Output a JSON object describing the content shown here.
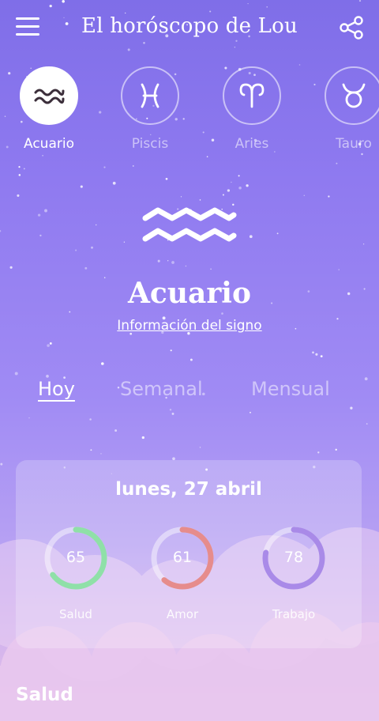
{
  "header": {
    "title": "El horóscopo de Lou",
    "menu_icon": "hamburger-menu-icon",
    "share_icon": "share-icon"
  },
  "signs": [
    {
      "label": "Acuario",
      "icon": "aquarius-icon",
      "active": true
    },
    {
      "label": "Piscis",
      "icon": "pisces-icon",
      "active": false
    },
    {
      "label": "Aries",
      "icon": "aries-icon",
      "active": false
    },
    {
      "label": "Tauro",
      "icon": "taurus-icon",
      "active": false
    }
  ],
  "hero": {
    "name": "Acuario",
    "info_link": "Información del signo",
    "icon": "aquarius-icon"
  },
  "tabs": [
    {
      "label": "Hoy",
      "active": true
    },
    {
      "label": "Semanal",
      "active": false
    },
    {
      "label": "Mensual",
      "active": false
    }
  ],
  "card": {
    "date": "lunes, 27 abril",
    "gauges": [
      {
        "label": "Salud",
        "value": 65,
        "color": "#8fe0a8"
      },
      {
        "label": "Amor",
        "value": 61,
        "color": "#e68c8c"
      },
      {
        "label": "Trabajo",
        "value": 78,
        "color": "#a98ae8"
      }
    ]
  },
  "section": {
    "title": "Salud"
  },
  "colors": {
    "accent_purple": "#8b74ef",
    "aquarius_glyph": "#3b2e3a"
  }
}
